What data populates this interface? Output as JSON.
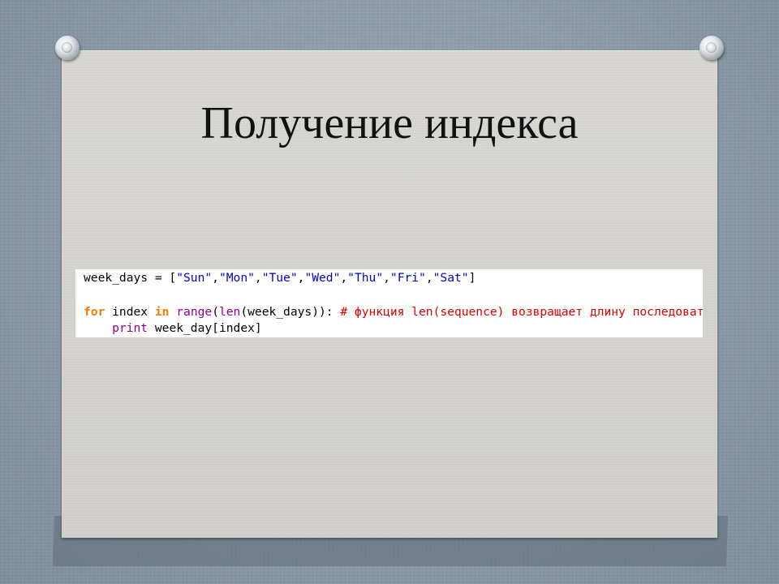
{
  "slide": {
    "title": "Получение индекса"
  },
  "code": {
    "line1": {
      "var": "week_days",
      "assign": " = [",
      "items": [
        "\"Sun\"",
        "\"Mon\"",
        "\"Tue\"",
        "\"Wed\"",
        "\"Thu\"",
        "\"Fri\"",
        "\"Sat\""
      ],
      "sep": ",",
      "close": "]"
    },
    "line2": {
      "kw_for": "for",
      "t1": " index ",
      "kw_in": "in",
      "t2": " ",
      "fn_range": "range",
      "t3": "(",
      "fn_len": "len",
      "t4": "(week_days)): ",
      "comment": "# функция len(sequence) возвращает длину последовательности"
    },
    "line3": {
      "indent": "    ",
      "kw_print": "print",
      "rest": " week_day[index]"
    }
  },
  "colors": {
    "keyword": "#ff7700",
    "builtin": "#900090",
    "string": "#0000cc",
    "comment": "#dd0000"
  }
}
